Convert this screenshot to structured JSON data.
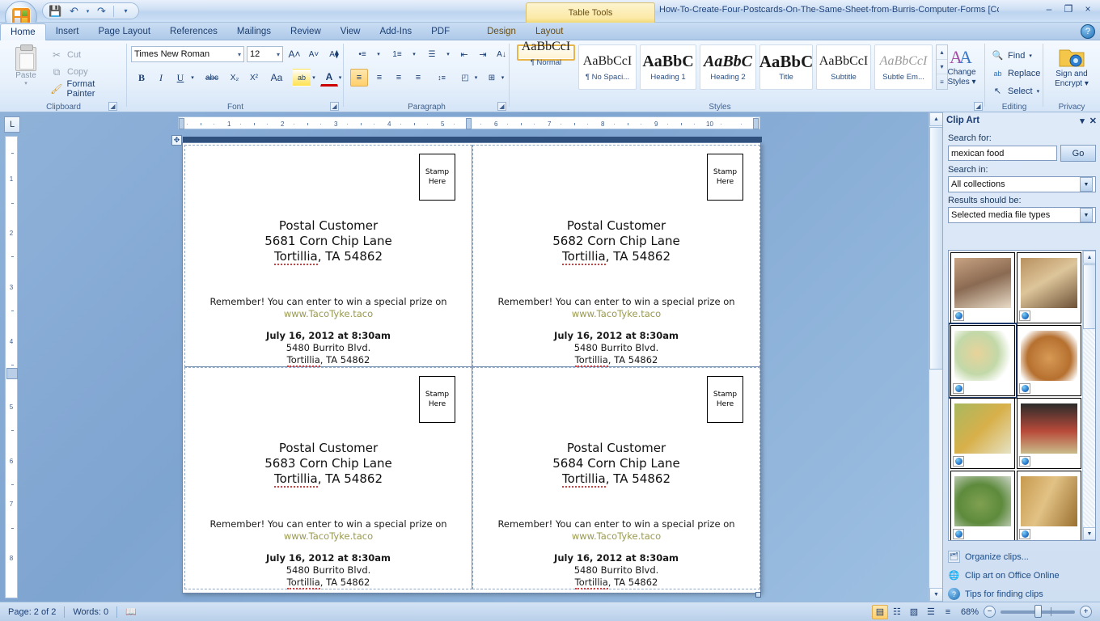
{
  "window": {
    "document_title": "How-To-Create-Four-Postcards-On-The-Same-Sheet-from-Burris-Computer-Forms [Compatibility ... M.",
    "contextual_tab_group": "Table Tools",
    "minimize": "–",
    "restore": "❐",
    "close": "×",
    "help": "?"
  },
  "quick_access": {
    "save": "💾",
    "undo": "↶",
    "undo_arrow": "▾",
    "redo": "↷",
    "customize": "▾"
  },
  "tabs": [
    {
      "label": "Home",
      "active": true
    },
    {
      "label": "Insert",
      "active": false
    },
    {
      "label": "Page Layout",
      "active": false
    },
    {
      "label": "References",
      "active": false
    },
    {
      "label": "Mailings",
      "active": false
    },
    {
      "label": "Review",
      "active": false
    },
    {
      "label": "View",
      "active": false
    },
    {
      "label": "Add-Ins",
      "active": false
    },
    {
      "label": "PDF",
      "active": false
    },
    {
      "label": "Design",
      "active": false,
      "contextual": true
    },
    {
      "label": "Layout",
      "active": false,
      "contextual": true
    }
  ],
  "ribbon": {
    "clipboard": {
      "group_label": "Clipboard",
      "paste": "Paste",
      "paste_arrow": "▾",
      "cut": "Cut",
      "cut_icon": "✂",
      "copy": "Copy",
      "copy_icon": "⧉",
      "format_painter": "Format Painter",
      "format_painter_icon": "🖌"
    },
    "font": {
      "group_label": "Font",
      "font_name": "Times New Roman",
      "font_size": "12",
      "grow_font": "A˄",
      "shrink_font": "A˅",
      "clear_formatting": "A⧫",
      "bold": "B",
      "italic": "I",
      "underline": "U",
      "strikethrough": "abc",
      "subscript": "X₂",
      "superscript": "X²",
      "change_case": "Aa",
      "text_highlight": "ab",
      "font_color": "A"
    },
    "paragraph": {
      "group_label": "Paragraph",
      "bullets": "•≡",
      "numbering": "1≡",
      "multilevel": "☰",
      "decrease_indent": "⇤",
      "increase_indent": "⇥",
      "sort": "A↓",
      "show_marks": "¶",
      "align_left": "≡",
      "align_center": "≡",
      "align_right": "≡",
      "justify": "≡",
      "line_spacing": "↕≡",
      "shading": "◰",
      "borders": "⊞"
    },
    "styles": {
      "group_label": "Styles",
      "items": [
        {
          "preview": "AaBbCcI",
          "name": "¶ Normal",
          "selected": true,
          "font": "serif",
          "size": 16,
          "weight": "normal",
          "style": "normal",
          "color": "#1a1a1a"
        },
        {
          "preview": "AaBbCcI",
          "name": "¶ No Spaci...",
          "selected": false,
          "font": "serif",
          "size": 16,
          "weight": "normal",
          "style": "normal",
          "color": "#1a1a1a"
        },
        {
          "preview": "AaBbC",
          "name": "Heading 1",
          "selected": false,
          "font": "serif",
          "size": 19,
          "weight": "bold",
          "style": "normal",
          "color": "#1a1a1a"
        },
        {
          "preview": "AaBbC",
          "name": "Heading 2",
          "selected": false,
          "font": "serif",
          "size": 19,
          "weight": "bold",
          "style": "italic",
          "color": "#1a1a1a"
        },
        {
          "preview": "AaBbC",
          "name": "Title",
          "selected": false,
          "font": "serif",
          "size": 20,
          "weight": "bold",
          "style": "normal",
          "color": "#1a1a1a"
        },
        {
          "preview": "AaBbCcI",
          "name": "Subtitle",
          "selected": false,
          "font": "serif",
          "size": 15,
          "weight": "normal",
          "style": "normal",
          "color": "#1a1a1a"
        },
        {
          "preview": "AaBbCcI",
          "name": "Subtle Em...",
          "selected": false,
          "font": "serif",
          "size": 15,
          "weight": "normal",
          "style": "italic",
          "color": "#8a8a8a"
        }
      ],
      "scroll_up": "▴",
      "scroll_down": "▾",
      "more": "≡",
      "change_styles_line1": "Change",
      "change_styles_line2": "Styles ▾"
    },
    "editing": {
      "group_label": "Editing",
      "find": "Find",
      "find_arrow": "▾",
      "find_icon": "🔍",
      "replace": "Replace",
      "replace_icon": "ab",
      "select": "Select",
      "select_arrow": "▾",
      "select_icon": "↖"
    },
    "privacy": {
      "group_label": "Privacy",
      "sign_line1": "Sign and",
      "sign_line2": "Encrypt ▾"
    }
  },
  "ruler": {
    "corner_tab_stop": "L",
    "h_labels": [
      "1",
      "2",
      "3",
      "4",
      "5",
      "6",
      "7",
      "8",
      "9",
      "10"
    ],
    "v_labels": [
      "1",
      "2",
      "3",
      "4",
      "5",
      "6",
      "7",
      "8"
    ]
  },
  "document": {
    "postcards": [
      {
        "stamp_line1": "Stamp",
        "stamp_line2": "Here",
        "addr_line1": "Postal Customer",
        "addr_line2": "5681 Corn Chip Lane",
        "addr_city": "Tortillia",
        "addr_rest": ", TA 54862",
        "promo_text": "Remember! You can enter to win a special prize on",
        "promo_url": "www.TacoTyke.taco",
        "event_date": "July 16, 2012 at 8:30am",
        "event_addr1": "5480 Burrito Blvd.",
        "event_city": "Tortillia",
        "event_rest": ", TA 54862"
      },
      {
        "stamp_line1": "Stamp",
        "stamp_line2": "Here",
        "addr_line1": "Postal Customer",
        "addr_line2": "5682 Corn Chip Lane",
        "addr_city": "Tortillia",
        "addr_rest": ", TA 54862",
        "promo_text": "Remember! You can enter to win a special prize on",
        "promo_url": "www.TacoTyke.taco",
        "event_date": "July 16, 2012 at 8:30am",
        "event_addr1": "5480 Burrito Blvd.",
        "event_city": "Tortillia",
        "event_rest": ", TA 54862"
      },
      {
        "stamp_line1": "Stamp",
        "stamp_line2": "Here",
        "addr_line1": "Postal Customer",
        "addr_line2": "5683 Corn Chip Lane",
        "addr_city": "Tortillia",
        "addr_rest": ", TA 54862",
        "promo_text": "Remember! You can enter to win a special prize on",
        "promo_url": "www.TacoTyke.taco",
        "event_date": "July 16, 2012 at 8:30am",
        "event_addr1": "5480 Burrito Blvd.",
        "event_city": "Tortillia",
        "event_rest": ", TA 54862"
      },
      {
        "stamp_line1": "Stamp",
        "stamp_line2": "Here",
        "addr_line1": "Postal Customer",
        "addr_line2": "5684 Corn Chip Lane",
        "addr_city": "Tortillia",
        "addr_rest": ", TA 54862",
        "promo_text": "Remember! You can enter to win a special prize on",
        "promo_url": "www.TacoTyke.taco",
        "event_date": "July 16, 2012 at 8:30am",
        "event_addr1": "5480 Burrito Blvd.",
        "event_city": "Tortillia",
        "event_rest": ", TA 54862"
      }
    ]
  },
  "clip_art_pane": {
    "title": "Clip Art",
    "menu_arrow": "▾",
    "close": "✕",
    "search_for_label": "Search for:",
    "search_value": "mexican food",
    "search_placeholder": "",
    "go_button": "Go",
    "search_in_label": "Search in:",
    "search_in_value": "All collections",
    "results_label": "Results should be:",
    "results_value": "Selected media file types",
    "dropdown_arrow": "▾",
    "scroll_up": "▲",
    "scroll_down": "▼",
    "thumbnails": [
      {
        "alt": "hands-shaping-tortillas-photo",
        "selected": false,
        "c1": "#c8a282",
        "c2": "#8a6a52",
        "c3": "#e8dcc8"
      },
      {
        "alt": "tortilla-dough-rounds-photo",
        "selected": false,
        "c1": "#b8905f",
        "c2": "#6d5136",
        "c3": "#ddc59a"
      },
      {
        "alt": "taco-plate-illustration",
        "selected": true,
        "c1": "#e8d39a",
        "c2": "#c2d8a8",
        "c3": "#e0a0a0"
      },
      {
        "alt": "fried-bread-photo",
        "selected": false,
        "c1": "#d79a55",
        "c2": "#b6702f",
        "c3": "#efc999"
      },
      {
        "alt": "vegetable-medley-photo",
        "selected": false,
        "c1": "#a8b860",
        "c2": "#d8b04a",
        "c3": "#e5e2c5"
      },
      {
        "alt": "vegetable-market-display-photo",
        "selected": false,
        "c1": "#2b2b2b",
        "c2": "#b84a3a",
        "c3": "#c9bb8a"
      },
      {
        "alt": "green-salsa-bowl-photo",
        "selected": false,
        "c1": "#7fa050",
        "c2": "#5d8a3c",
        "c3": "#cdd5c8"
      },
      {
        "alt": "wheat-sheaf-photo",
        "selected": false,
        "c1": "#c79a4e",
        "c2": "#9a7030",
        "c3": "#e2c285"
      }
    ],
    "links": [
      {
        "label": "Organize clips...",
        "icon": "🗂"
      },
      {
        "label": "Clip art on Office Online",
        "icon": "🌐"
      },
      {
        "label": "Tips for finding clips",
        "icon": "?"
      }
    ]
  },
  "status_bar": {
    "page_info": "Page: 2 of 2",
    "word_count": "Words: 0",
    "proofing_icon": "📖",
    "zoom_level": "68%",
    "zoom_out": "−",
    "zoom_in": "+",
    "view_buttons": [
      {
        "name": "print-layout",
        "glyph": "▤",
        "active": true
      },
      {
        "name": "full-screen-reading",
        "glyph": "☷",
        "active": false
      },
      {
        "name": "web-layout",
        "glyph": "▧",
        "active": false
      },
      {
        "name": "outline",
        "glyph": "☰",
        "active": false
      },
      {
        "name": "draft",
        "glyph": "≡",
        "active": false
      }
    ]
  }
}
